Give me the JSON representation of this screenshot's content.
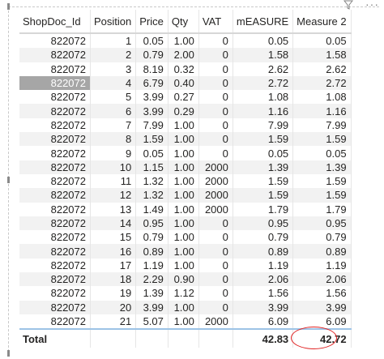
{
  "visual": {
    "columns": [
      "ShopDoc_Id",
      "Position",
      "Price",
      "Qty",
      "VAT",
      "mEASURE",
      "Measure 2"
    ],
    "rows": [
      [
        "822072",
        "1",
        "0.05",
        "1.00",
        "0",
        "0.05",
        "0.05"
      ],
      [
        "822072",
        "2",
        "0.79",
        "2.00",
        "0",
        "1.58",
        "1.58"
      ],
      [
        "822072",
        "3",
        "8.19",
        "0.32",
        "0",
        "2.62",
        "2.62"
      ],
      [
        "822072",
        "4",
        "6.79",
        "0.40",
        "0",
        "2.72",
        "2.72"
      ],
      [
        "822072",
        "5",
        "3.99",
        "0.27",
        "0",
        "1.08",
        "1.08"
      ],
      [
        "822072",
        "6",
        "3.99",
        "0.29",
        "0",
        "1.16",
        "1.16"
      ],
      [
        "822072",
        "7",
        "7.99",
        "1.00",
        "0",
        "7.99",
        "7.99"
      ],
      [
        "822072",
        "8",
        "1.59",
        "1.00",
        "0",
        "1.59",
        "1.59"
      ],
      [
        "822072",
        "9",
        "0.05",
        "1.00",
        "0",
        "0.05",
        "0.05"
      ],
      [
        "822072",
        "10",
        "1.15",
        "1.00",
        "2000",
        "1.39",
        "1.39"
      ],
      [
        "822072",
        "11",
        "1.32",
        "1.00",
        "2000",
        "1.59",
        "1.59"
      ],
      [
        "822072",
        "12",
        "1.32",
        "1.00",
        "2000",
        "1.59",
        "1.59"
      ],
      [
        "822072",
        "13",
        "1.49",
        "1.00",
        "2000",
        "1.79",
        "1.79"
      ],
      [
        "822072",
        "14",
        "0.95",
        "1.00",
        "0",
        "0.95",
        "0.95"
      ],
      [
        "822072",
        "15",
        "0.79",
        "1.00",
        "0",
        "0.79",
        "0.79"
      ],
      [
        "822072",
        "16",
        "0.89",
        "1.00",
        "0",
        "0.89",
        "0.89"
      ],
      [
        "822072",
        "17",
        "1.19",
        "1.00",
        "0",
        "1.19",
        "1.19"
      ],
      [
        "822072",
        "18",
        "2.29",
        "0.90",
        "0",
        "2.06",
        "2.06"
      ],
      [
        "822072",
        "19",
        "1.39",
        "1.12",
        "0",
        "1.56",
        "1.56"
      ],
      [
        "822072",
        "20",
        "3.99",
        "1.00",
        "0",
        "3.99",
        "3.99"
      ],
      [
        "822072",
        "21",
        "5.07",
        "1.00",
        "2000",
        "6.09",
        "6.09"
      ]
    ],
    "selected_row_index": 3,
    "total": {
      "label": "Total",
      "measure": "42.83",
      "measure2": "42.72"
    },
    "icons": {
      "filter": "filter-icon",
      "more": "more-options-icon"
    },
    "colors": {
      "band": "#f2f2f2",
      "selected": "#a6a6a6",
      "total_border": "#9dc3e6",
      "annotation": "#e02020"
    }
  }
}
